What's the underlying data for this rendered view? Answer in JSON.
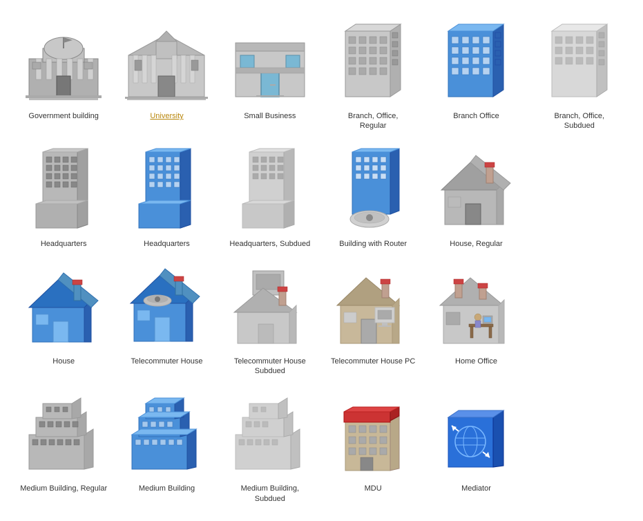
{
  "items": [
    {
      "id": "government-building",
      "label": "Government building",
      "highlight": false
    },
    {
      "id": "university",
      "label": "University",
      "highlight": true
    },
    {
      "id": "small-business",
      "label": "Small Business",
      "highlight": false
    },
    {
      "id": "branch-office-regular",
      "label": "Branch, Office,\nRegular",
      "highlight": false
    },
    {
      "id": "branch-office",
      "label": "Branch Office",
      "highlight": false
    },
    {
      "id": "branch-office-subdued",
      "label": "Branch, Office,\nSubdued",
      "highlight": false
    },
    {
      "id": "headquarters",
      "label": "Headquarters",
      "highlight": false
    },
    {
      "id": "headquarters2",
      "label": "Headquarters",
      "highlight": false
    },
    {
      "id": "headquarters-subdued",
      "label": "Headquarters, Subdued",
      "highlight": false
    },
    {
      "id": "building-with-router",
      "label": "Building with Router",
      "highlight": false
    },
    {
      "id": "house-regular",
      "label": "House, Regular",
      "highlight": false
    },
    {
      "id": "empty1",
      "label": "",
      "highlight": false
    },
    {
      "id": "house",
      "label": "House",
      "highlight": false
    },
    {
      "id": "telecommuter-house",
      "label": "Telecommuter House",
      "highlight": false
    },
    {
      "id": "telecommuter-house-subdued",
      "label": "Telecommuter House\nSubdued",
      "highlight": false
    },
    {
      "id": "telecommuter-house-pc",
      "label": "Telecommuter House PC",
      "highlight": false
    },
    {
      "id": "home-office",
      "label": "Home Office",
      "highlight": false
    },
    {
      "id": "empty2",
      "label": "",
      "highlight": false
    },
    {
      "id": "medium-building-regular",
      "label": "Medium Building, Regular",
      "highlight": false
    },
    {
      "id": "medium-building",
      "label": "Medium Building",
      "highlight": false
    },
    {
      "id": "medium-building-subdued",
      "label": "Medium Building, Subdued",
      "highlight": false
    },
    {
      "id": "mdu",
      "label": "MDU",
      "highlight": false
    },
    {
      "id": "mediator",
      "label": "Mediator",
      "highlight": false
    },
    {
      "id": "empty3",
      "label": "",
      "highlight": false
    }
  ]
}
